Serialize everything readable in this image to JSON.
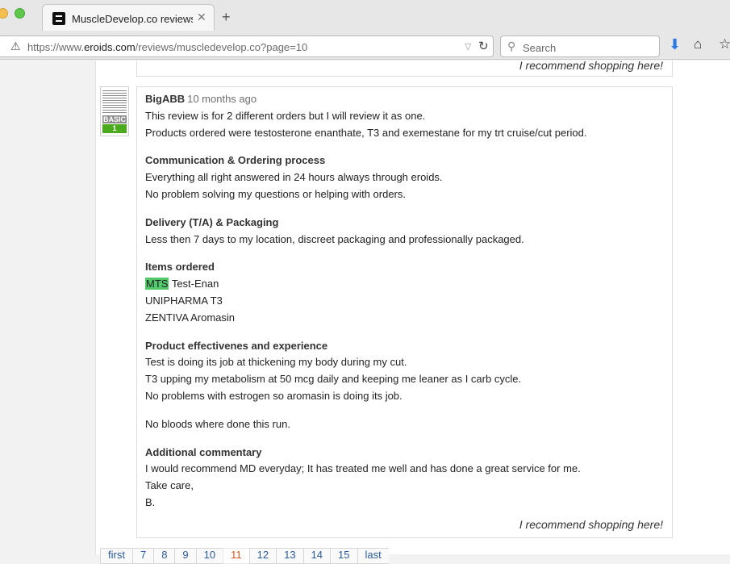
{
  "browser": {
    "tab_title": "MuscleDevelop.co reviews. ...",
    "tab_close": "✕",
    "new_tab": "+",
    "url_prefix": "https://www.",
    "url_domain": "eroids.com",
    "url_path": "/reviews/muscledevelop.co?page=10",
    "search_placeholder": "Search"
  },
  "previous_review": {
    "recommend_text": "I recommend shopping here!"
  },
  "review": {
    "author": "BigABB",
    "age": "10 months ago",
    "avatar_badge": "BASIC",
    "avatar_level": "1",
    "intro": [
      "This review is for 2 different orders but I will review it as one.",
      "Products ordered were testosterone enanthate, T3 and exemestane for my trt cruise/cut period."
    ],
    "communication_title": "Communication & Ordering process",
    "communication": [
      "Everything all right answered in 24 hours always through eroids.",
      "No problem solving my questions or helping with orders."
    ],
    "delivery_title": "Delivery (T/A) & Packaging",
    "delivery": [
      "Less then 7 days to my location, discreet packaging and professionally packaged."
    ],
    "items_title": "Items ordered",
    "item1_brand": "MTS",
    "item1_rest": " Test-Enan",
    "item2": "UNIPHARMA T3",
    "item3": "ZENTIVA Aromasin",
    "effect_title": "Product effectivenes and experience",
    "effect": [
      "Test is doing its job at thickening my body during my cut.",
      "T3 upping my metabolism at 50 mcg daily and keeping me leaner as I carb cycle.",
      "No problems with estrogen so aromasin is doing its job."
    ],
    "bloods": "No bloods where done this run.",
    "commentary_title": "Additional commentary",
    "commentary": [
      "I would recommend MD everyday; It has treated me well and has done a great service for me.",
      "Take care,",
      "B."
    ],
    "recommend_text": "I recommend shopping here!"
  },
  "pagination": {
    "items": [
      "first",
      "7",
      "8",
      "9",
      "10",
      "11",
      "12",
      "13",
      "14",
      "15",
      "last"
    ],
    "current": "11"
  },
  "colors": {
    "highlight": "#52c96b",
    "level_badge": "#4caa1f",
    "current_page": "#d9531e"
  }
}
